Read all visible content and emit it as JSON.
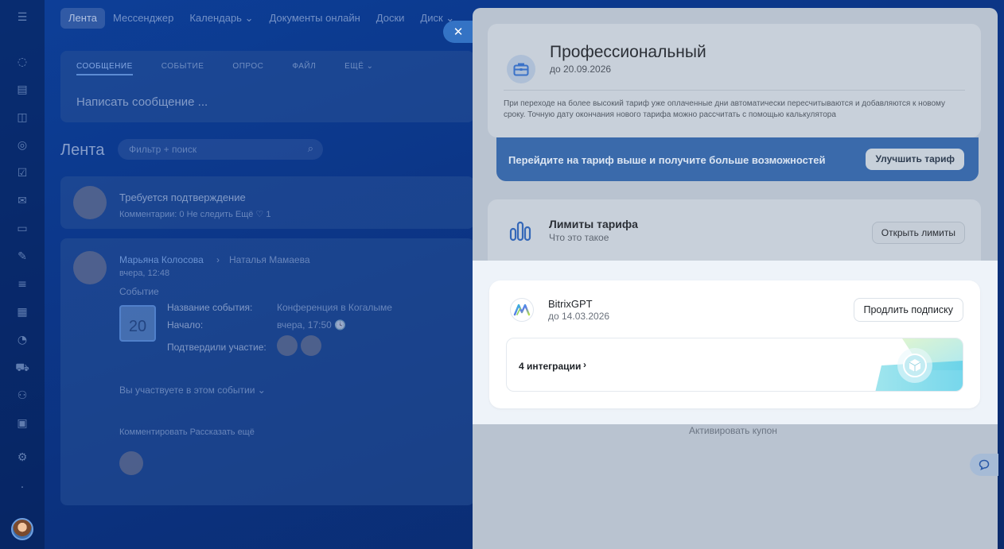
{
  "topnav": {
    "items": [
      "Лента",
      "Мессенджер",
      "Календарь ⌄",
      "Документы онлайн",
      "Доски",
      "Диск ⌄"
    ]
  },
  "composer": {
    "tabs": [
      "СООБЩЕНИЕ",
      "СОБЫТИЕ",
      "ОПРОС",
      "ФАЙЛ",
      "ЕЩЁ ⌄"
    ],
    "placeholder": "Написать сообщение ..."
  },
  "feed": {
    "title": "Лента",
    "search_placeholder": "Фильтр + поиск",
    "post1": {
      "title": "Требуется подтверждение",
      "meta": "Комментарии: 0   Не следить   Ещё   ♡ 1"
    },
    "post2": {
      "author": "Марьяна Колосова",
      "recipient": "Наталья Мамаева",
      "time": "вчера, 12:48",
      "type": "Событие",
      "event_name_label": "Название события:",
      "event_name": "Конференция в Когалыме",
      "start_label": "Начало:",
      "start": "вчера, 17:50 🕓",
      "confirmed_label": "Подтвердили участие:",
      "calendar_day": "20",
      "participate": "Вы участвуете в этом событии ⌄",
      "comment_prompt": "Комментировать  Рассказать ещё"
    }
  },
  "slider": {
    "close_label": "✕",
    "plan": {
      "title": "Профессиональный",
      "until": "до 20.09.2026",
      "note": "При переходе на более высокий тариф уже оплаченные дни автоматически пересчитываются и добавляются к новому сроку. Точную дату окончания нового тарифа можно рассчитать с помощью калькулятора"
    },
    "upgrade": {
      "text": "Перейдите на тариф выше и получите больше возможностей",
      "button": "Улучшить тариф"
    },
    "limits": {
      "title": "Лимиты тарифа",
      "subtitle": "Что это такое",
      "button": "Открыть лимиты"
    },
    "gpt": {
      "title": "BitrixGPT",
      "until": "до 14.03.2026",
      "renew_button": "Продлить подписку",
      "integrations": "4 интеграции"
    },
    "coupon": "Активировать купон"
  },
  "colors": {
    "app_bg": "#0d3f98",
    "accent_blue": "#2f6fd6",
    "highlight_bg": "#eef3f9"
  }
}
